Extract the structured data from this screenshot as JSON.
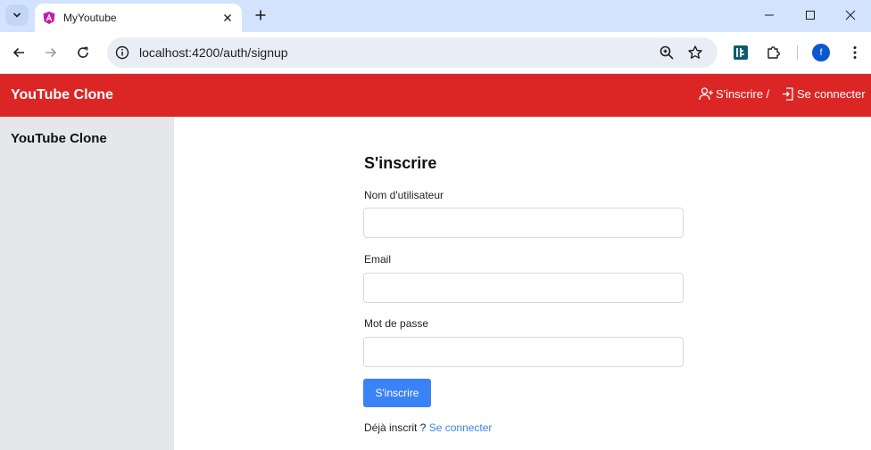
{
  "browser": {
    "tab_title": "MyYoutube",
    "url": "localhost:4200/auth/signup",
    "profile_initial": "f"
  },
  "app": {
    "brand": "YouTube Clone",
    "header_links": [
      {
        "label": "S'inscrire /",
        "icon": "user-plus-icon"
      },
      {
        "label": "Se connecter",
        "icon": "login-icon"
      }
    ],
    "accent": "#dc2626"
  },
  "sidebar": {
    "title": "YouTube Clone"
  },
  "form": {
    "title": "S'inscrire",
    "fields": [
      {
        "label": "Nom d'utilisateur",
        "value": ""
      },
      {
        "label": "Email",
        "value": ""
      },
      {
        "label": "Mot de passe",
        "value": ""
      }
    ],
    "submit_label": "S'inscrire",
    "already_text": "Déjà inscrit ?",
    "login_link": "Se connecter",
    "button_color": "#3b82f6"
  }
}
